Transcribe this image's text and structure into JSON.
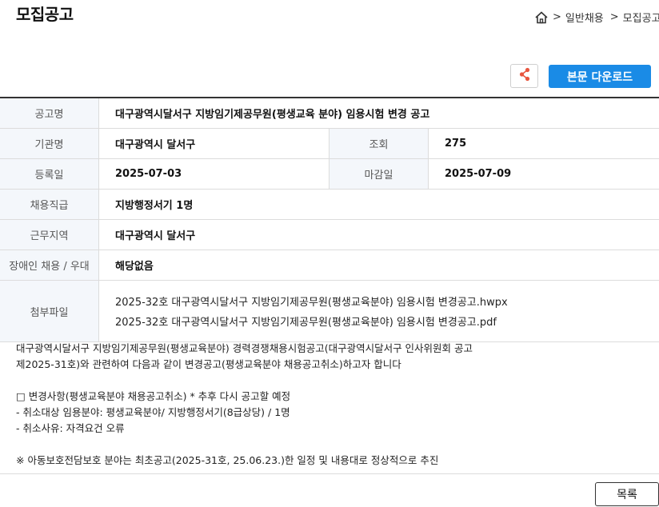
{
  "page_title": "모집공고",
  "breadcrumb": {
    "items": [
      "일반채용",
      "모집공고"
    ],
    "separator": ">"
  },
  "buttons": {
    "download": "본문 다운로드",
    "list": "목록"
  },
  "colors": {
    "primary": "#1a8be6",
    "share_icon": "#e8563f",
    "label_bg": "#f4f7fb"
  },
  "details": {
    "title_label": "공고명",
    "title_value": "대구광역시달서구 지방임기제공무원(평생교육 분야) 임용시험 변경 공고",
    "org_label": "기관명",
    "org_value": "대구광역시 달서구",
    "views_label": "조회",
    "views_value": "275",
    "reg_label": "등록일",
    "reg_value": "2025-07-03",
    "deadline_label": "마감일",
    "deadline_value": "2025-07-09",
    "grade_label": "채용직급",
    "grade_value": "지방행정서기 1명",
    "region_label": "근무지역",
    "region_value": "대구광역시 달서구",
    "disability_label": "장애인 채용 / 우대",
    "disability_value": "해당없음",
    "files_label": "첨부파일",
    "files": [
      "2025-32호 대구광역시달서구 지방임기제공무원(평생교육분야) 임용시험 변경공고.hwpx",
      "2025-32호 대구광역시달서구 지방임기제공무원(평생교육분야) 임용시험 변경공고.pdf"
    ]
  },
  "body": {
    "line1": "대구광역시달서구 지방임기제공무원(평생교육분야) 경력경쟁채용시험공고(대구광역시달서구 인사위원회 공고",
    "line2": "제2025-31호)와 관련하여 다음과 같이 변경공고(평생교육분야 채용공고취소)하고자 합니다",
    "line3": "□ 변경사항(평생교육분야 채용공고취소) * 추후 다시 공고할 예정",
    "line4": "- 취소대상 임용분야: 평생교육분야/ 지방행정서기(8급상당) / 1명",
    "line5": "- 취소사유: 자격요건 오류",
    "line6": "※ 아동보호전담보호 분야는 최초공고(2025-31호, 25.06.23.)한 일정 및 내용대로 정상적으로 추진"
  }
}
